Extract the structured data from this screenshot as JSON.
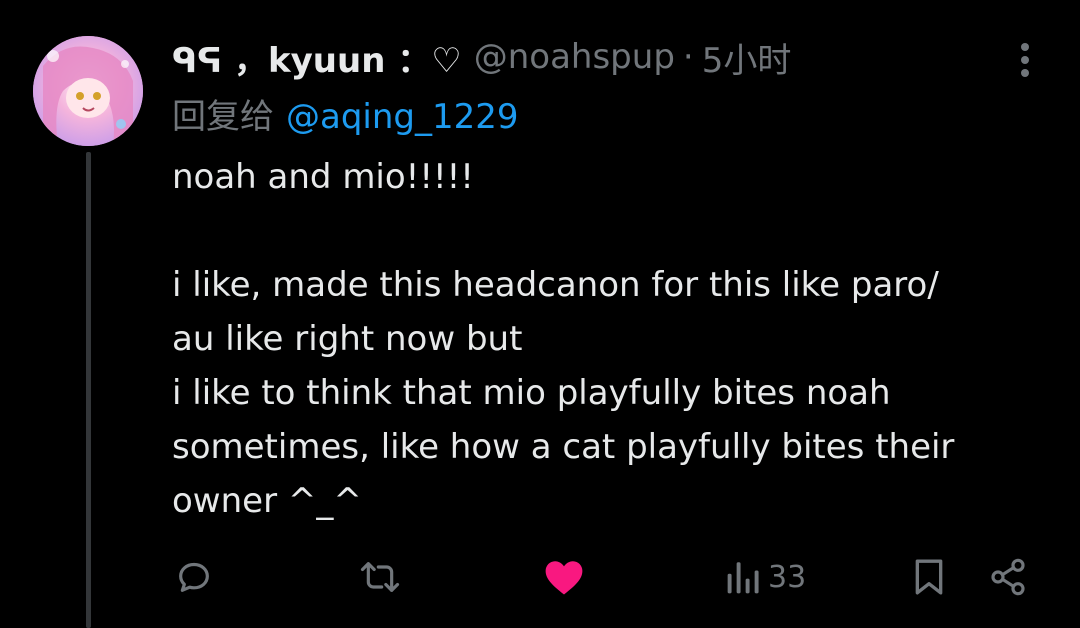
{
  "tweet": {
    "display_name": "ᑫᕋ ，kyuun ：♡",
    "handle": "@noahspup",
    "time_label": "5小时",
    "reply_prefix": "回复给",
    "reply_to": "@aqing_1229",
    "body_lines": [
      "noah and mio!!!!!",
      "",
      "i like, made this headcanon for this like paro/",
      "au like right now but",
      "i like to think that mio playfully bites noah",
      "sometimes, like how a cat playfully bites their",
      "owner ^_^"
    ]
  },
  "actions": {
    "views": "33",
    "liked": true
  },
  "colors": {
    "background": "#000000",
    "text": "#e7e9ea",
    "muted": "#71767b",
    "link": "#1d9bf0",
    "like": "#f91880",
    "thread_line": "#333639"
  }
}
